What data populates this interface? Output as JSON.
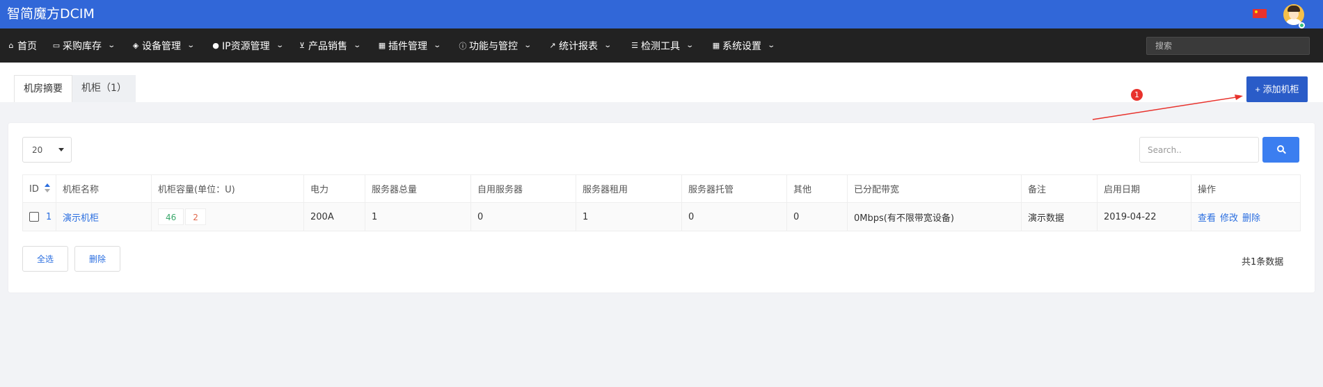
{
  "app": {
    "title": "智简魔方DCIM"
  },
  "nav": {
    "items": [
      {
        "icon": "home-icon",
        "glyph": "⌂",
        "label": "首页",
        "has_dropdown": false
      },
      {
        "icon": "truck-icon",
        "glyph": "▭",
        "label": "采购库存",
        "has_dropdown": true
      },
      {
        "icon": "cube-icon",
        "glyph": "◈",
        "label": "设备管理",
        "has_dropdown": true
      },
      {
        "icon": "map-marker-icon",
        "glyph": "●",
        "label": "IP资源管理",
        "has_dropdown": true
      },
      {
        "icon": "cart-icon",
        "glyph": "⊻",
        "label": "产品销售",
        "has_dropdown": true
      },
      {
        "icon": "grid-icon",
        "glyph": "▦",
        "label": "插件管理",
        "has_dropdown": true
      },
      {
        "icon": "info-icon",
        "glyph": "ⓘ",
        "label": "功能与管控",
        "has_dropdown": true
      },
      {
        "icon": "line-chart-icon",
        "glyph": "↗",
        "label": "统计报表",
        "has_dropdown": true
      },
      {
        "icon": "list-icon",
        "glyph": "☰",
        "label": "检测工具",
        "has_dropdown": true
      },
      {
        "icon": "th-large-icon",
        "glyph": "▦",
        "label": "系统设置",
        "has_dropdown": true
      }
    ],
    "search_placeholder": "搜索"
  },
  "tabs": [
    {
      "label": "机房摘要",
      "active": true
    },
    {
      "label": "机柜（1）",
      "active": false
    }
  ],
  "add_button": "+ 添加机柜",
  "annotation": {
    "number": "1",
    "color": "#e8322c"
  },
  "table_controls": {
    "page_size": "20",
    "search_placeholder": "Search.."
  },
  "table": {
    "columns": [
      "ID",
      "机柜名称",
      "机柜容量(单位：U)",
      "电力",
      "服务器总量",
      "自用服务器",
      "服务器租用",
      "服务器托管",
      "其他",
      "已分配带宽",
      "备注",
      "启用日期",
      "操作"
    ],
    "rows": [
      {
        "id": "1",
        "name": "演示机柜",
        "cap_used": "46",
        "cap_free": "2",
        "power": "200A",
        "server_total": "1",
        "self_use": "0",
        "rent": "1",
        "hosting": "0",
        "other": "0",
        "bandwidth": "0Mbps(有不限带宽设备)",
        "remark": "演示数据",
        "start_date": "2019-04-22",
        "actions": [
          "查看",
          "修改",
          "删除"
        ]
      }
    ]
  },
  "footer": {
    "select_all": "全选",
    "delete": "删除",
    "total": "共1条数据"
  },
  "colors": {
    "topbar": "#3167d8",
    "navbar": "#222222",
    "primary_button": "#2a5cc8",
    "link": "#2a6ee0",
    "capacity_used": "#3aa86b",
    "capacity_free": "#e0664a"
  }
}
